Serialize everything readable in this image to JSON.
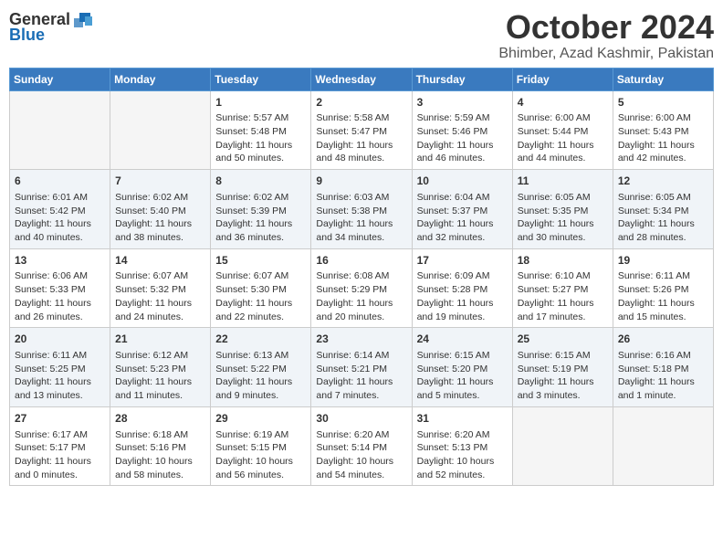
{
  "logo": {
    "general": "General",
    "blue": "Blue"
  },
  "title": "October 2024",
  "location": "Bhimber, Azad Kashmir, Pakistan",
  "headers": [
    "Sunday",
    "Monday",
    "Tuesday",
    "Wednesday",
    "Thursday",
    "Friday",
    "Saturday"
  ],
  "weeks": [
    [
      {
        "day": "",
        "info": ""
      },
      {
        "day": "",
        "info": ""
      },
      {
        "day": "1",
        "info": "Sunrise: 5:57 AM\nSunset: 5:48 PM\nDaylight: 11 hours and 50 minutes."
      },
      {
        "day": "2",
        "info": "Sunrise: 5:58 AM\nSunset: 5:47 PM\nDaylight: 11 hours and 48 minutes."
      },
      {
        "day": "3",
        "info": "Sunrise: 5:59 AM\nSunset: 5:46 PM\nDaylight: 11 hours and 46 minutes."
      },
      {
        "day": "4",
        "info": "Sunrise: 6:00 AM\nSunset: 5:44 PM\nDaylight: 11 hours and 44 minutes."
      },
      {
        "day": "5",
        "info": "Sunrise: 6:00 AM\nSunset: 5:43 PM\nDaylight: 11 hours and 42 minutes."
      }
    ],
    [
      {
        "day": "6",
        "info": "Sunrise: 6:01 AM\nSunset: 5:42 PM\nDaylight: 11 hours and 40 minutes."
      },
      {
        "day": "7",
        "info": "Sunrise: 6:02 AM\nSunset: 5:40 PM\nDaylight: 11 hours and 38 minutes."
      },
      {
        "day": "8",
        "info": "Sunrise: 6:02 AM\nSunset: 5:39 PM\nDaylight: 11 hours and 36 minutes."
      },
      {
        "day": "9",
        "info": "Sunrise: 6:03 AM\nSunset: 5:38 PM\nDaylight: 11 hours and 34 minutes."
      },
      {
        "day": "10",
        "info": "Sunrise: 6:04 AM\nSunset: 5:37 PM\nDaylight: 11 hours and 32 minutes."
      },
      {
        "day": "11",
        "info": "Sunrise: 6:05 AM\nSunset: 5:35 PM\nDaylight: 11 hours and 30 minutes."
      },
      {
        "day": "12",
        "info": "Sunrise: 6:05 AM\nSunset: 5:34 PM\nDaylight: 11 hours and 28 minutes."
      }
    ],
    [
      {
        "day": "13",
        "info": "Sunrise: 6:06 AM\nSunset: 5:33 PM\nDaylight: 11 hours and 26 minutes."
      },
      {
        "day": "14",
        "info": "Sunrise: 6:07 AM\nSunset: 5:32 PM\nDaylight: 11 hours and 24 minutes."
      },
      {
        "day": "15",
        "info": "Sunrise: 6:07 AM\nSunset: 5:30 PM\nDaylight: 11 hours and 22 minutes."
      },
      {
        "day": "16",
        "info": "Sunrise: 6:08 AM\nSunset: 5:29 PM\nDaylight: 11 hours and 20 minutes."
      },
      {
        "day": "17",
        "info": "Sunrise: 6:09 AM\nSunset: 5:28 PM\nDaylight: 11 hours and 19 minutes."
      },
      {
        "day": "18",
        "info": "Sunrise: 6:10 AM\nSunset: 5:27 PM\nDaylight: 11 hours and 17 minutes."
      },
      {
        "day": "19",
        "info": "Sunrise: 6:11 AM\nSunset: 5:26 PM\nDaylight: 11 hours and 15 minutes."
      }
    ],
    [
      {
        "day": "20",
        "info": "Sunrise: 6:11 AM\nSunset: 5:25 PM\nDaylight: 11 hours and 13 minutes."
      },
      {
        "day": "21",
        "info": "Sunrise: 6:12 AM\nSunset: 5:23 PM\nDaylight: 11 hours and 11 minutes."
      },
      {
        "day": "22",
        "info": "Sunrise: 6:13 AM\nSunset: 5:22 PM\nDaylight: 11 hours and 9 minutes."
      },
      {
        "day": "23",
        "info": "Sunrise: 6:14 AM\nSunset: 5:21 PM\nDaylight: 11 hours and 7 minutes."
      },
      {
        "day": "24",
        "info": "Sunrise: 6:15 AM\nSunset: 5:20 PM\nDaylight: 11 hours and 5 minutes."
      },
      {
        "day": "25",
        "info": "Sunrise: 6:15 AM\nSunset: 5:19 PM\nDaylight: 11 hours and 3 minutes."
      },
      {
        "day": "26",
        "info": "Sunrise: 6:16 AM\nSunset: 5:18 PM\nDaylight: 11 hours and 1 minute."
      }
    ],
    [
      {
        "day": "27",
        "info": "Sunrise: 6:17 AM\nSunset: 5:17 PM\nDaylight: 11 hours and 0 minutes."
      },
      {
        "day": "28",
        "info": "Sunrise: 6:18 AM\nSunset: 5:16 PM\nDaylight: 10 hours and 58 minutes."
      },
      {
        "day": "29",
        "info": "Sunrise: 6:19 AM\nSunset: 5:15 PM\nDaylight: 10 hours and 56 minutes."
      },
      {
        "day": "30",
        "info": "Sunrise: 6:20 AM\nSunset: 5:14 PM\nDaylight: 10 hours and 54 minutes."
      },
      {
        "day": "31",
        "info": "Sunrise: 6:20 AM\nSunset: 5:13 PM\nDaylight: 10 hours and 52 minutes."
      },
      {
        "day": "",
        "info": ""
      },
      {
        "day": "",
        "info": ""
      }
    ]
  ]
}
